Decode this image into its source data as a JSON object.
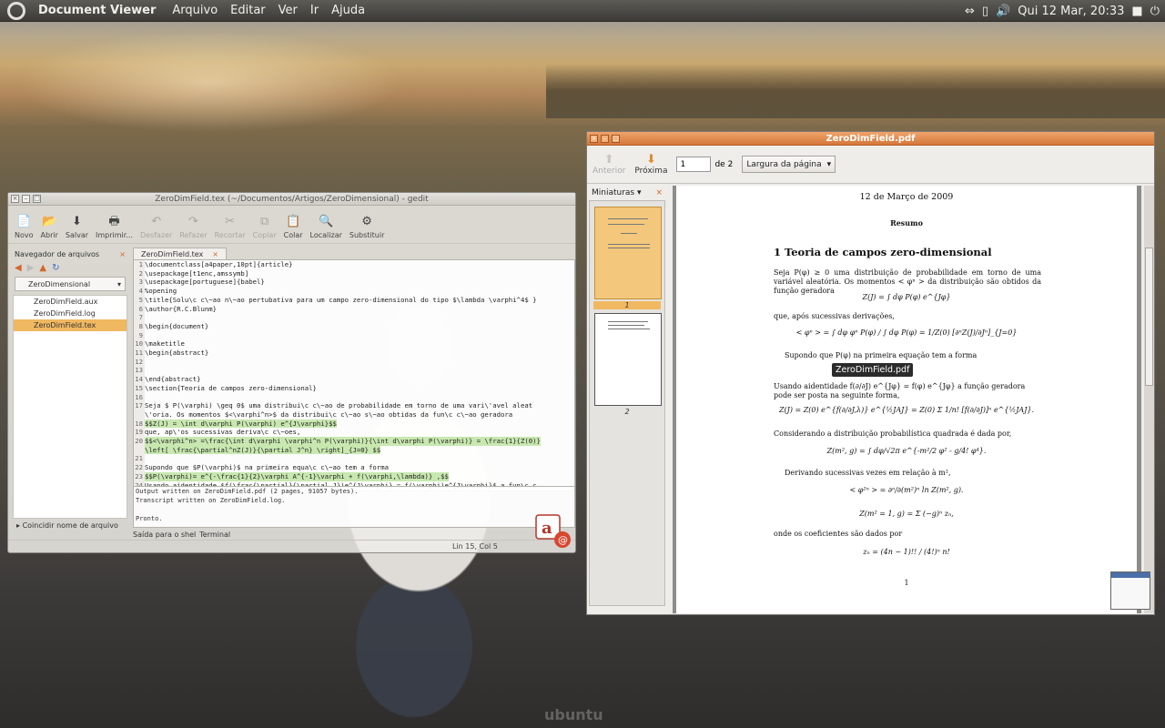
{
  "top_panel": {
    "app_title": "Document Viewer",
    "menus": [
      "Arquivo",
      "Editar",
      "Ver",
      "Ir",
      "Ajuda"
    ],
    "clock": "Qui 12 Mar, 20:33"
  },
  "gedit": {
    "title": "ZeroDimField.tex (~/Documentos/Artigos/ZeroDimensional) - gedit",
    "toolbar": [
      "Novo",
      "Abrir",
      "Salvar",
      "Imprimir...",
      "Desfazer",
      "Refazer",
      "Recortar",
      "Copiar",
      "Colar",
      "Localizar",
      "Substituir"
    ],
    "side_title": "Navegador de arquivos",
    "side_folder": "ZeroDimensional",
    "files": [
      "ZeroDimField.aux",
      "ZeroDimField.log",
      "ZeroDimField.tex"
    ],
    "side_footer": "Coincidir nome de arquivo",
    "tab": "ZeroDimField.tex",
    "code": [
      {
        "n": "1",
        "t": "\\documentclass[a4paper,10pt]{article}"
      },
      {
        "n": "2",
        "t": "\\usepackage[t1enc,amssymb]"
      },
      {
        "n": "3",
        "t": "\\usepackage[portuguese]{babel}"
      },
      {
        "n": "4",
        "t": "%opening"
      },
      {
        "n": "5",
        "t": "\\title{Solu\\c c\\~ao n\\~ao pertubativa para um campo zero-dimensional do tipo $\\lambda \\varphi^4$ }"
      },
      {
        "n": "6",
        "t": "\\author{R.C.Blunm}"
      },
      {
        "n": "7",
        "t": ""
      },
      {
        "n": "8",
        "t": "\\begin{document}"
      },
      {
        "n": "9",
        "t": ""
      },
      {
        "n": "10",
        "t": "\\maketitle"
      },
      {
        "n": "11",
        "t": "\\begin{abstract}"
      },
      {
        "n": "12",
        "t": ""
      },
      {
        "n": "13",
        "t": ""
      },
      {
        "n": "14",
        "t": "\\end{abstract}"
      },
      {
        "n": "15",
        "t": "\\section{Teoria de campos zero-dimensional}"
      },
      {
        "n": "16",
        "t": ""
      },
      {
        "n": "17",
        "t": "Seja $ P(\\varphi) \\geq 0$ uma distribui\\c c\\~ao de probabilidade em torno de uma vari\\'avel aleat"
      },
      {
        "n": "",
        "t": "\\'oria. Os momentos $<\\varphi^n>$ da distribui\\c c\\~ao s\\~ao obtidas da fun\\c c\\~ao geradora"
      },
      {
        "n": "18",
        "t": "$$Z(J) = \\int d\\varphi P(\\varphi) e^{J\\varphi}$$"
      },
      {
        "n": "19",
        "t": "que, ap\\'os sucessivas deriva\\c c\\~oes,"
      },
      {
        "n": "20",
        "t": "$$<\\varphi^n> =\\frac{\\int d\\varphi \\varphi^n P(\\varphi)}{\\int d\\varphi P(\\varphi)} = \\frac{1}{Z(0)}"
      },
      {
        "n": "",
        "t": "\\left[ \\frac{\\partial^nZ(J)}{\\partial J^n} \\right]_{J=0} $$"
      },
      {
        "n": "21",
        "t": ""
      },
      {
        "n": "22",
        "t": "Supondo que $P(\\varphi)$ na primeira equa\\c c\\~ao tem a forma"
      },
      {
        "n": "23",
        "t": "$$P(\\varphi)= e^{-\\frac{1}{2}\\varphi A^{-1}\\varphi + f(\\varphi,\\lambda)} ,$$"
      },
      {
        "n": "24",
        "t": "Usando aidentidade $f(\\frac{\\partial}{\\partial J})e^{J\\varphi} = f(\\varphi)e^{J\\varphi}$ a fun\\c c"
      }
    ],
    "output": [
      "Output written on ZeroDimField.pdf (2 pages, 91057 bytes).",
      "Transcript written on ZeroDimField.log.",
      "",
      "Pronto."
    ],
    "bottom_tabs": [
      "Saída para o shel",
      "Terminal"
    ],
    "status": "Lin 15, Col 5"
  },
  "evince": {
    "title": "ZeroDimField.pdf",
    "prev_label": "Anterior",
    "next_label": "Próxima",
    "page_value": "1",
    "page_of": "de 2",
    "zoom": "Largura da página",
    "side_label": "Miniaturas",
    "thumb_labels": [
      "1",
      "2"
    ],
    "tooltip": "ZeroDimField.pdf",
    "page": {
      "date": "12 de Março de 2009",
      "abstract": "Resumo",
      "section": "1    Teoria de campos zero-dimensional",
      "p1": "Seja P(φ) ≥ 0 uma distribuição de probabilidade em torno de uma variável aleatória. Os momentos < φⁿ > da distribuição são obtidos da função geradora",
      "eq1": "Z(J) = ∫ dφ P(φ) e^{Jφ}",
      "p2": "que, após sucessivas derivações,",
      "eq2": "< φⁿ > = ∫ dφ φⁿ P(φ) / ∫ dφ P(φ) = 1/Z(0) [∂ⁿZ(J)/∂Jⁿ]_{J=0}",
      "p3": "Supondo que P(φ) na primeira equação tem a forma",
      "p4": "Usando aidentidade f(∂/∂J) e^{Jφ} = f(φ) e^{Jφ} a função geradora pode ser posta na seguinte forma,",
      "eq4": "Z(J) = Z(0) e^{f(∂/∂J,λ)} e^{½JAJ} = Z(0) Σ 1/n! [f(∂/∂J)]ⁿ e^{½JAJ}.",
      "p5": "Considerando a distribuição probabilística quadrada é dada por,",
      "eq5": "Z(m², g) = ∫ dφ/√2π e^{-m²/2 φ² - g/4! φ⁴}.",
      "p6": "Derivando sucessivas vezes em relação à m²,",
      "eq6": "< φ²ⁿ > = ∂ⁿ/∂(m²)ⁿ ln Z(m², g).",
      "eq7": "Z(m² = 1, g) = Σ (−g)ⁿ zₙ,",
      "p7": "onde os coeficientes são dados por",
      "eq8": "zₙ = (4n − 1)!! / (4!)ⁿ n!",
      "page_number": "1"
    }
  }
}
